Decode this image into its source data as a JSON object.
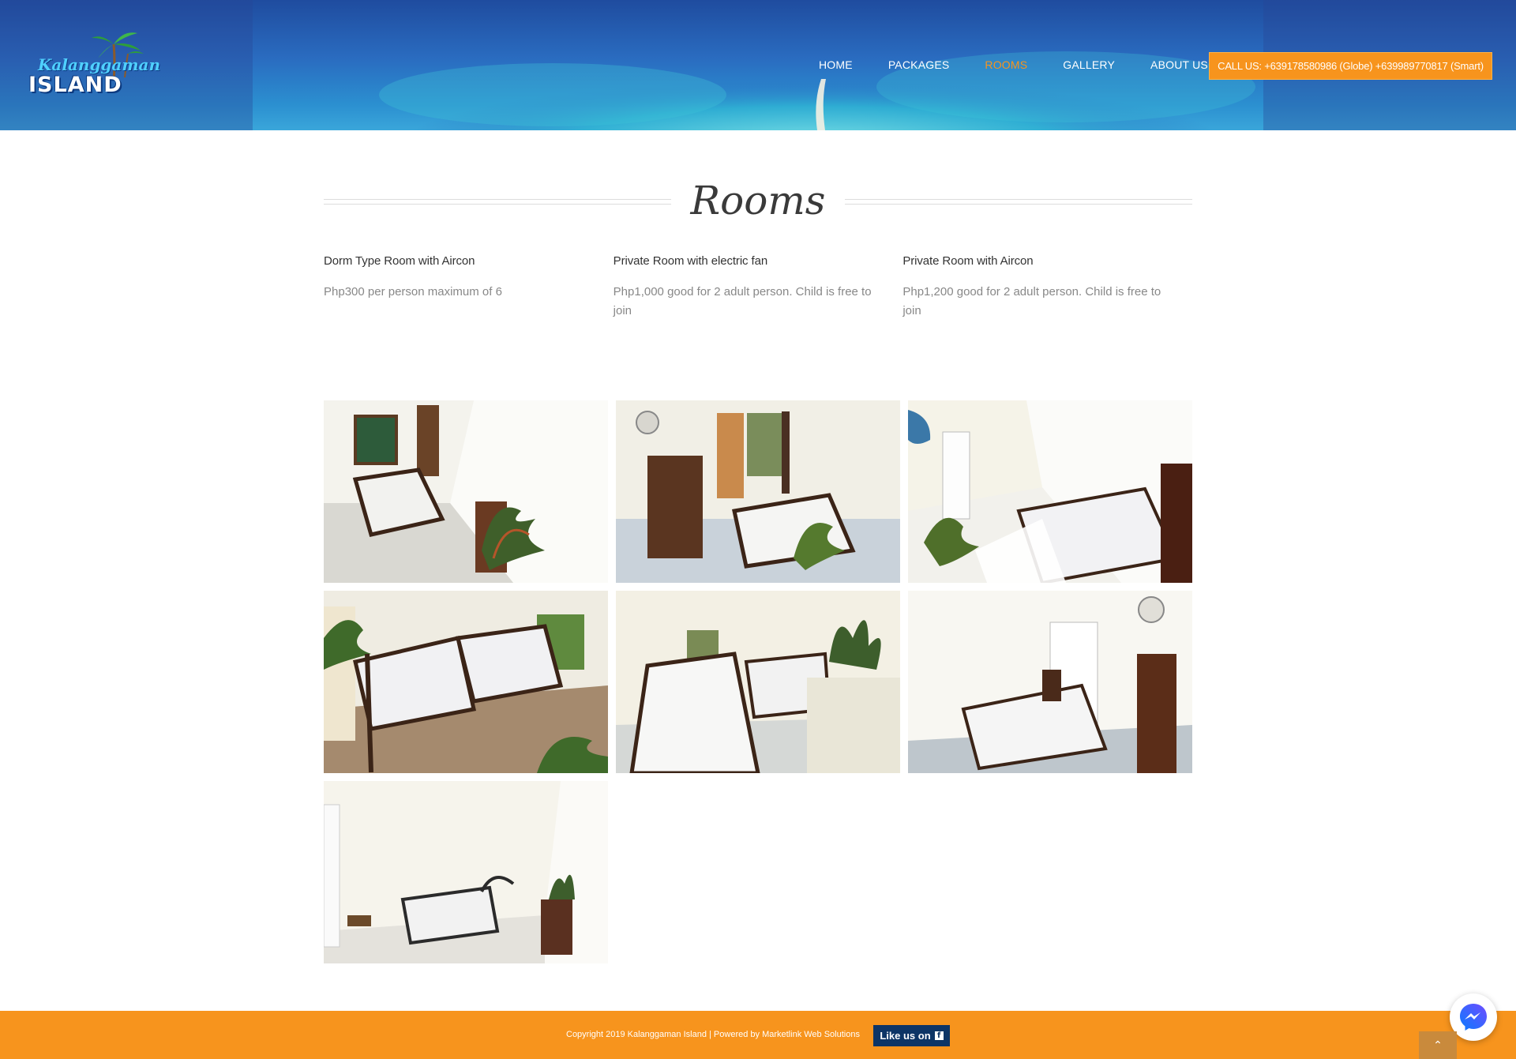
{
  "site": {
    "logo_script": "Kalanggaman",
    "logo_word": "ISLAND"
  },
  "nav": {
    "items": [
      {
        "label": "HOME",
        "active": false
      },
      {
        "label": "PACKAGES",
        "active": false
      },
      {
        "label": "ROOMS",
        "active": true
      },
      {
        "label": "GALLERY",
        "active": false
      },
      {
        "label": "ABOUT US",
        "active": false
      }
    ],
    "call_label": "CALL US: +639178580986 (Globe) +639989770817 (Smart)"
  },
  "page": {
    "title": "Rooms"
  },
  "rooms": [
    {
      "name": "Dorm Type Room with Aircon",
      "desc": "Php300 per person maximum of 6"
    },
    {
      "name": "Private Room with electric fan",
      "desc": "Php1,000 good for 2 adult person. Child is free to join"
    },
    {
      "name": "Private Room with Aircon",
      "desc": "Php1,200 good for 2 adult person. Child is free to join"
    }
  ],
  "gallery": {
    "photos": [
      {
        "name": "room-photo-1"
      },
      {
        "name": "room-photo-2"
      },
      {
        "name": "room-photo-3"
      },
      {
        "name": "room-photo-4"
      },
      {
        "name": "room-photo-5"
      },
      {
        "name": "room-photo-6"
      },
      {
        "name": "room-photo-7"
      }
    ]
  },
  "footer": {
    "copyright": "Copyright 2019 Kalanggaman Island | Powered by Marketlink Web Solutions",
    "like_label": "Like us on",
    "like_icon": "f"
  },
  "colors": {
    "accent": "#f7941d",
    "footer_button": "#0d3566",
    "header_sea": "#2a6cc0"
  },
  "icons": {
    "messenger": "messenger-icon",
    "scroll_top": "chevron-up-icon",
    "facebook": "facebook-icon"
  }
}
